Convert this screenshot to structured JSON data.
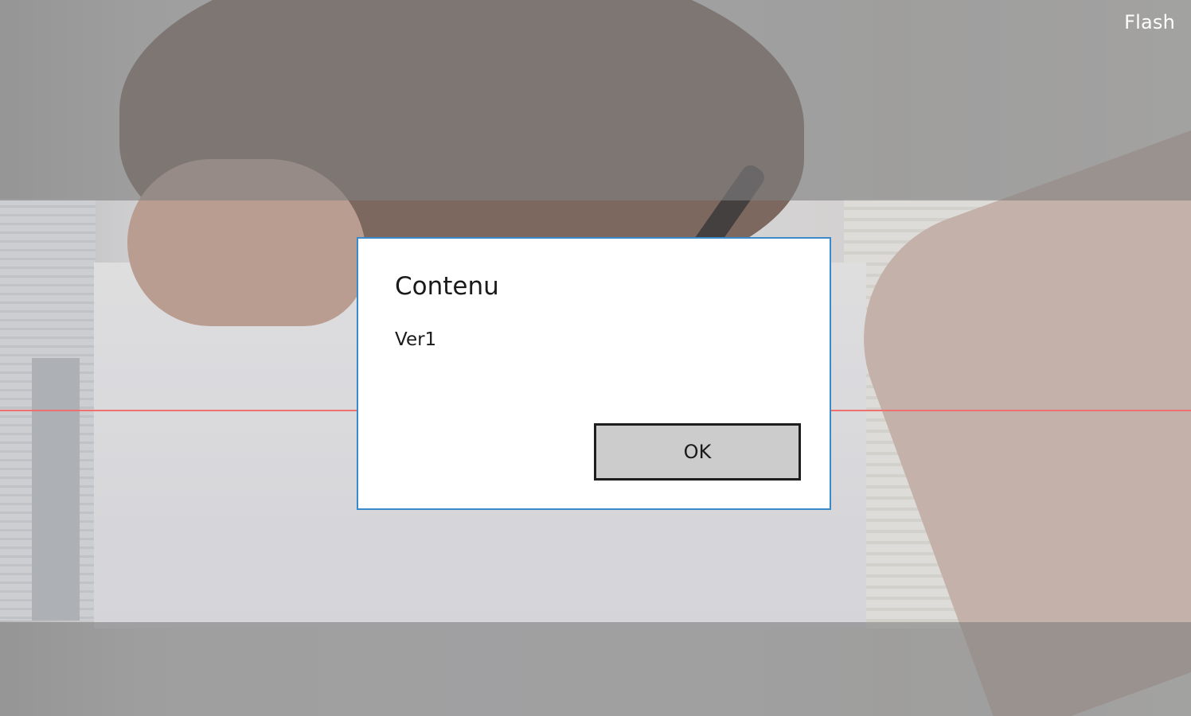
{
  "camera": {
    "flash_label": "Flash"
  },
  "dialog": {
    "title": "Contenu",
    "message": "Ver1",
    "ok_label": "OK"
  },
  "colors": {
    "dialog_border": "#3a89c9",
    "scan_line": "#f07070",
    "button_bg": "#cccccc",
    "button_border": "#1e1e1e"
  }
}
